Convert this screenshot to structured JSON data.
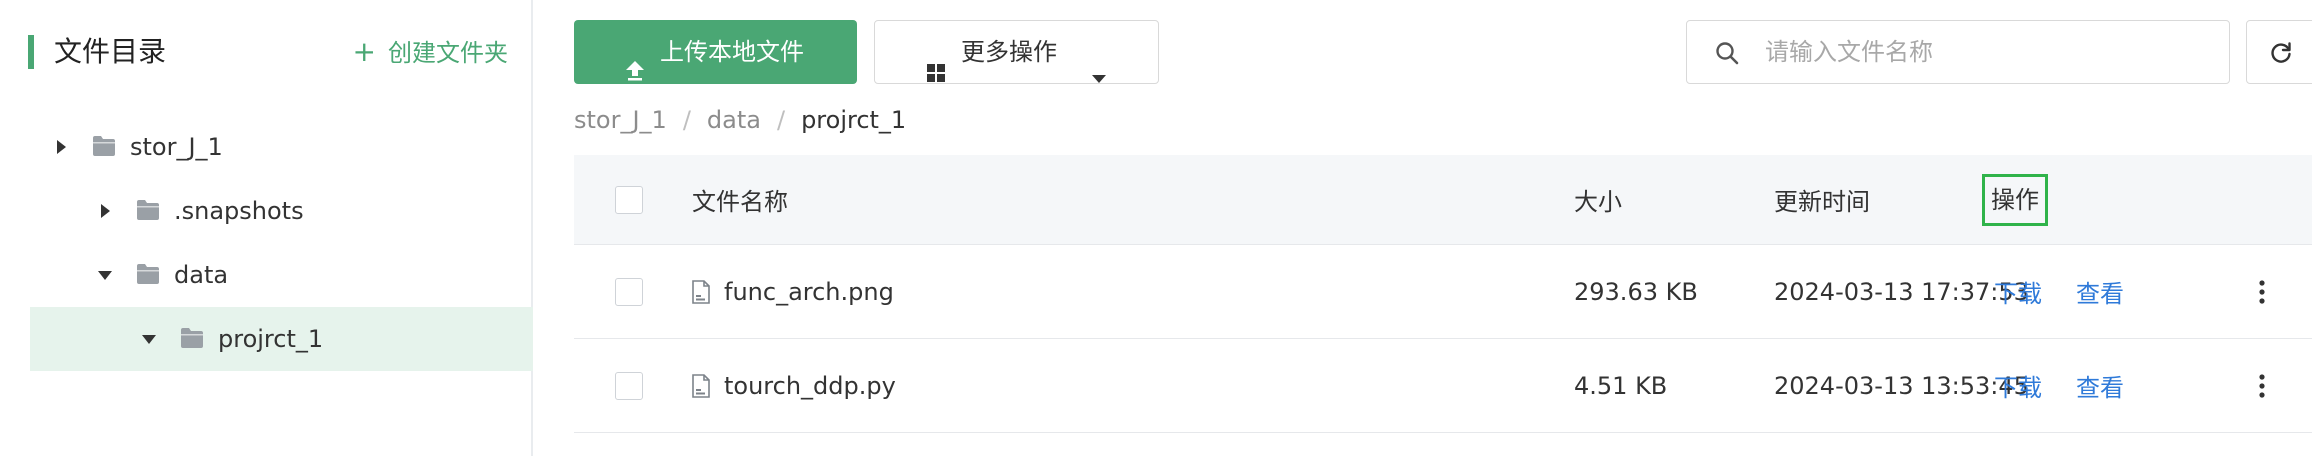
{
  "sidebar": {
    "title": "文件目录",
    "create_folder_label": "创建文件夹",
    "create_icon": "plus-icon",
    "tree": [
      {
        "label": "stor_J_1",
        "expanded": false,
        "selected": false
      },
      {
        "label": ".snapshots",
        "expanded": false,
        "selected": false
      },
      {
        "label": "data",
        "expanded": true,
        "selected": false
      },
      {
        "label": "projrct_1",
        "expanded": true,
        "selected": true
      }
    ]
  },
  "toolbar": {
    "upload_label": "上传本地文件",
    "upload_icon": "upload-icon",
    "more_label": "更多操作",
    "more_icon": "grid-icon",
    "search_placeholder": "请输入文件名称",
    "search_value": "",
    "refresh_icon": "refresh-icon"
  },
  "breadcrumb": [
    "stor_J_1",
    "data",
    "projrct_1"
  ],
  "table": {
    "columns": {
      "name": "文件名称",
      "size": "大小",
      "updated": "更新时间",
      "ops": "操作"
    },
    "rows": [
      {
        "name": "func_arch.png",
        "size": "293.63 KB",
        "updated": "2024-03-13 17:37:53",
        "download": "下载",
        "view": "查看"
      },
      {
        "name": "tourch_ddp.py",
        "size": "4.51 KB",
        "updated": "2024-03-13 13:53:45",
        "download": "下载",
        "view": "查看"
      }
    ]
  },
  "colors": {
    "accent": "#4aa774",
    "link": "#2f7ad9",
    "selected_bg": "#e6f3ec",
    "highlight_border": "#2fb34a"
  }
}
